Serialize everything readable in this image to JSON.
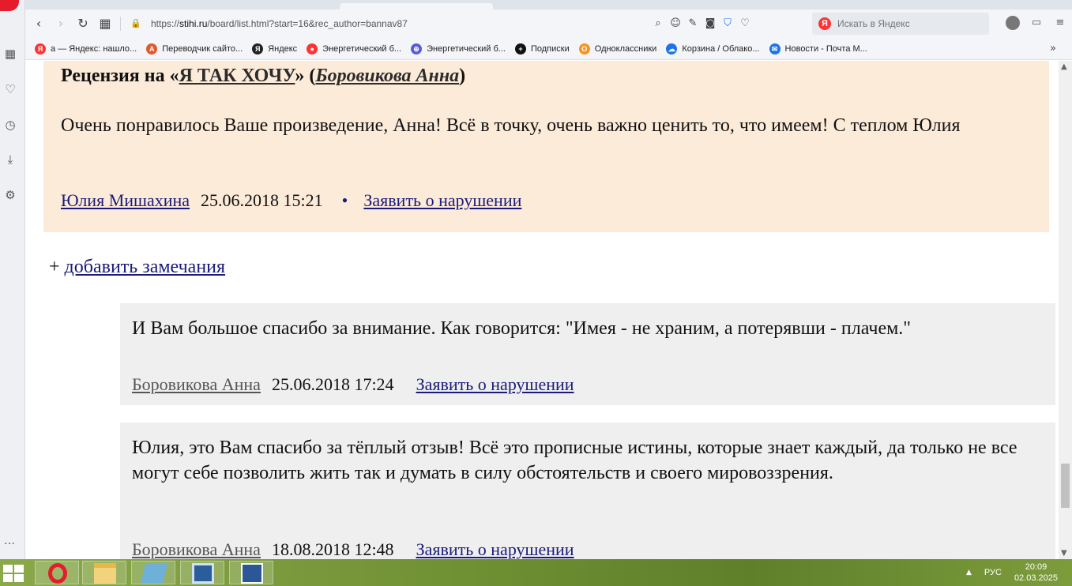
{
  "browser": {
    "url_prefix": "https://",
    "url_host": "stihi.ru",
    "url_path": "/board/list.html?start=16&rec_author=bannav87",
    "search_placeholder": "Искать в Яндекс",
    "search_badge": "Я",
    "bookmarks": [
      {
        "label": "а — Яндекс: нашло...",
        "color": "#f33",
        "glyph": "Я"
      },
      {
        "label": "Переводчик сайто...",
        "color": "#e05a2b",
        "glyph": "A"
      },
      {
        "label": "Яндекс",
        "color": "#222",
        "glyph": "Я"
      },
      {
        "label": "Энергетический б...",
        "color": "#f33",
        "glyph": "●"
      },
      {
        "label": "Энергетический б...",
        "color": "#5b5bd6",
        "glyph": "⊕"
      },
      {
        "label": "Подписки",
        "color": "#111",
        "glyph": "+"
      },
      {
        "label": "Одноклассники",
        "color": "#f7931e",
        "glyph": "О"
      },
      {
        "label": "Корзина / Облако...",
        "color": "#1a73e8",
        "glyph": "☁"
      },
      {
        "label": "Новости - Почта М...",
        "color": "#1a73e8",
        "glyph": "✉"
      }
    ],
    "bookmarks_more": "»"
  },
  "review": {
    "title_prefix": "Рецензия на «",
    "work_title": "Я ТАК ХОЧУ",
    "title_mid": "» (",
    "work_author": "Боровикова Анна",
    "title_suffix": ")",
    "text": "Очень понравилось Ваше произведение, Анна! Всё в точку, очень важно ценить то, что имеем! С теплом Юлия",
    "author": "Юлия Мишахина",
    "date": "25.06.2018 15:21",
    "bullet": "•",
    "report": "Заявить о нарушении"
  },
  "add_remark": {
    "plus": "+ ",
    "link": "добавить замечания"
  },
  "replies": [
    {
      "text": "И Вам большое спасибо за внимание. Как говорится: \"Имея - не храним, а потерявши - плачем.\"",
      "author": "Боровикова Анна",
      "date": "25.06.2018 17:24",
      "report": "Заявить о нарушении"
    },
    {
      "text": "Юлия, это Вам спасибо за тёплый отзыв! Всё это прописные истины, которые знает каждый, да только не все могут себе позволить жить так и думать в силу обстоятельств и своего мировоззрения.",
      "author": "Боровикова Анна",
      "date": "18.08.2018 12:48",
      "report": "Заявить о нарушении"
    }
  ],
  "taskbar": {
    "lang": "РУС",
    "time": "20:09",
    "date": "02.03.2025"
  },
  "colors": {
    "review_bg": "#fdebd9",
    "reply_bg": "#efefef",
    "link": "#1a1a7a"
  }
}
